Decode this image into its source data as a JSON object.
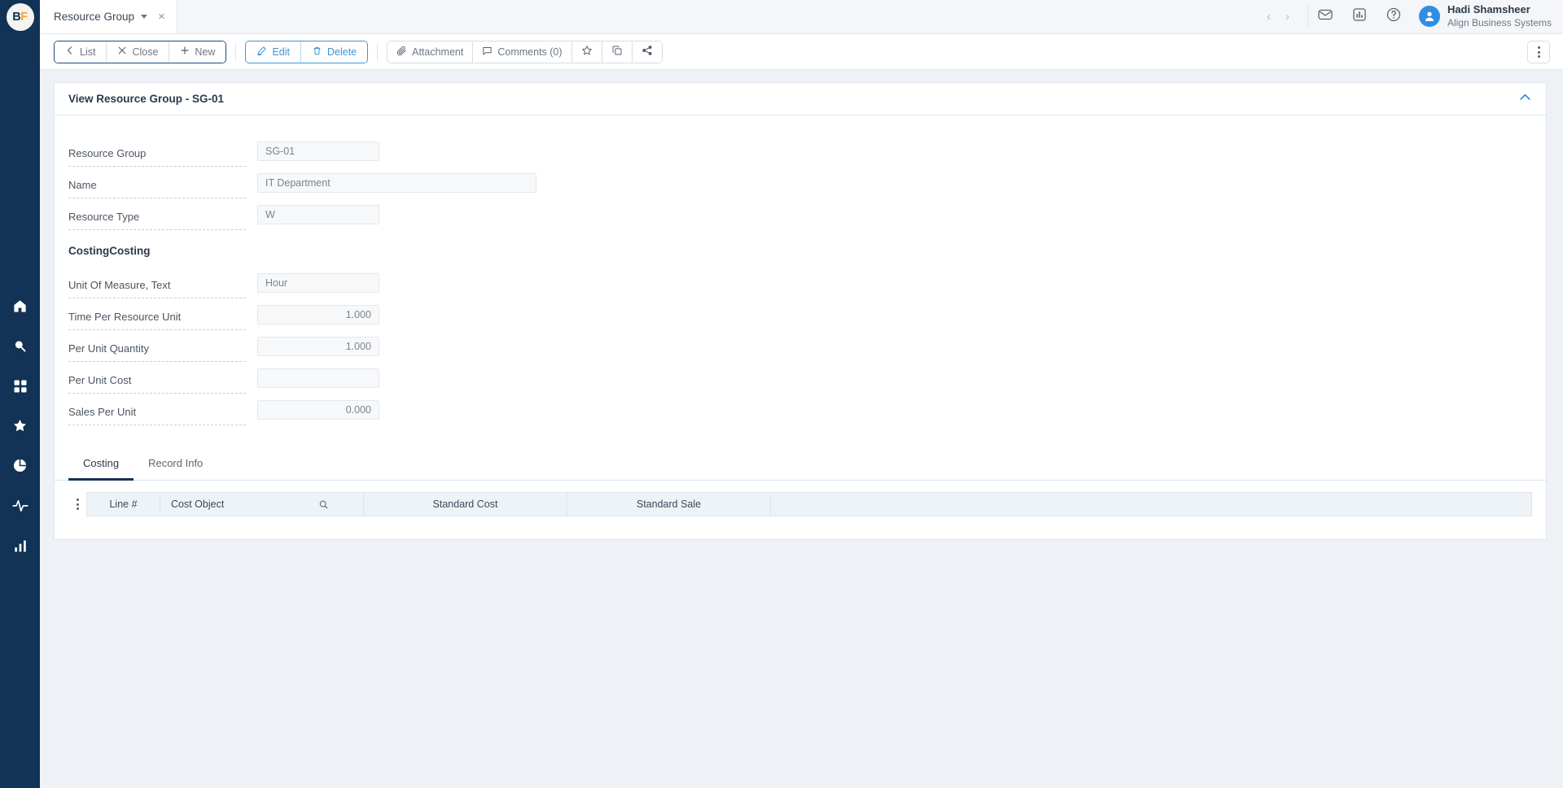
{
  "brand": {
    "logo_text_1": "B",
    "logo_text_2": "F",
    "accent": "#123256",
    "orange": "#f5a623",
    "link_blue": "#3c94d6"
  },
  "sidebar": {
    "items": [
      {
        "name": "home-icon",
        "label": "Home"
      },
      {
        "name": "search-icon",
        "label": "Search"
      },
      {
        "name": "apps-grid-icon",
        "label": "Apps"
      },
      {
        "name": "star-icon",
        "label": "Favorites"
      },
      {
        "name": "pie-chart-icon",
        "label": "Reports"
      },
      {
        "name": "activity-pulse-icon",
        "label": "Activity"
      },
      {
        "name": "bar-chart-icon",
        "label": "Analytics"
      }
    ]
  },
  "topbar": {
    "tab_label": "Resource Group",
    "tab_close": "×",
    "prev_arrow": "‹",
    "next_arrow": "›",
    "icons": [
      "mail-icon",
      "bar-chart-icon",
      "help-icon"
    ],
    "user": {
      "name": "Hadi Shamsheer",
      "org": "Align Business Systems"
    }
  },
  "toolbar": {
    "nav_group": [
      {
        "name": "list-button",
        "label": "List",
        "icon": "chevron-left-icon"
      },
      {
        "name": "close-button",
        "label": "Close",
        "icon": "close-icon"
      },
      {
        "name": "new-button",
        "label": "New",
        "icon": "plus-icon"
      }
    ],
    "action_group": [
      {
        "name": "edit-button",
        "label": "Edit",
        "icon": "pencil-icon"
      },
      {
        "name": "delete-button",
        "label": "Delete",
        "icon": "trash-icon"
      }
    ],
    "util_group": [
      {
        "name": "attachment-button",
        "label": "Attachment",
        "icon": "paperclip-icon"
      },
      {
        "name": "comments-button",
        "label": "Comments (0)",
        "icon": "comment-icon"
      }
    ],
    "icon_group": [
      {
        "name": "favorite-button",
        "icon": "star-icon"
      },
      {
        "name": "duplicate-button",
        "icon": "copy-icon"
      },
      {
        "name": "share-button",
        "icon": "share-icon"
      }
    ],
    "overflow": "kebab-menu-button"
  },
  "card": {
    "title": "View Resource Group - SG-01",
    "collapse_icon": "chevron-up-icon",
    "fields": [
      {
        "label": "Resource Group",
        "value": "SG-01",
        "size": "sm",
        "align": "left"
      },
      {
        "label": "Name",
        "value": "IT Department",
        "size": "lg",
        "align": "left"
      },
      {
        "label": "Resource Type",
        "value": "W",
        "size": "sm",
        "align": "left"
      }
    ],
    "section_title": "CostingCosting",
    "costing_fields": [
      {
        "label": "Unit Of Measure, Text",
        "value": "Hour",
        "size": "sm",
        "align": "left"
      },
      {
        "label": "Time Per Resource Unit",
        "value": "1.000",
        "size": "sm",
        "align": "right"
      },
      {
        "label": "Per Unit Quantity",
        "value": "1.000",
        "size": "sm",
        "align": "right"
      },
      {
        "label": "Per Unit Cost",
        "value": "",
        "size": "sm",
        "align": "right"
      },
      {
        "label": "Sales Per Unit",
        "value": "0.000",
        "size": "sm",
        "align": "right"
      }
    ],
    "tabs": [
      {
        "label": "Costing",
        "active": true
      },
      {
        "label": "Record Info",
        "active": false
      }
    ],
    "grid": {
      "row_menu": "row-kebab-icon",
      "columns": [
        {
          "label": "Line #",
          "cls": "c-line",
          "search": false
        },
        {
          "label": "Cost Object",
          "cls": "c-object",
          "search": true
        },
        {
          "label": "Standard Cost",
          "cls": "c-cost",
          "search": false
        },
        {
          "label": "Standard Sale",
          "cls": "c-sale",
          "search": false
        },
        {
          "label": "",
          "cls": "c-rest",
          "search": false
        }
      ],
      "rows": []
    }
  }
}
